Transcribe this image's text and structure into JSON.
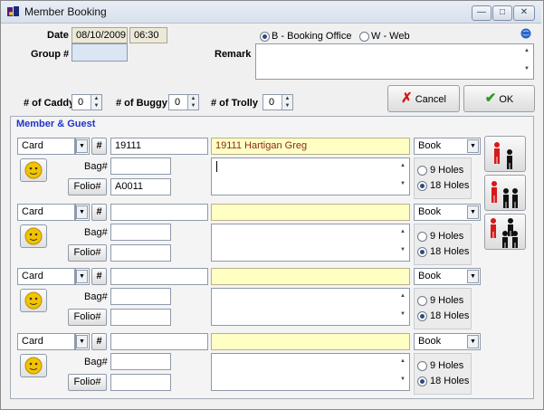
{
  "window": {
    "title": "Member Booking"
  },
  "header": {
    "date_label": "Date",
    "date_value": "08/10/2009",
    "time_value": "06:30",
    "group_label": "Group #",
    "group_value": "",
    "remark_label": "Remark",
    "booking_options": [
      {
        "label": "B - Booking Office",
        "selected": true
      },
      {
        "label": "W - Web",
        "selected": false
      }
    ],
    "caddy_label": "# of Caddy",
    "caddy_value": "0",
    "buggy_label": "# of Buggy",
    "buggy_value": "0",
    "trolly_label": "# of Trolly",
    "trolly_value": "0",
    "cancel_label": "Cancel",
    "ok_label": "OK"
  },
  "section": {
    "title": "Member & Guest"
  },
  "rows": [
    {
      "type": "Card",
      "hash": "#",
      "id": "19111",
      "name": "19111 Hartigan Greg",
      "status": "Book",
      "bag_label": "Bag#",
      "bag": "",
      "folio_label": "Folio#",
      "folio": "A0011",
      "hole_9": "9 Holes",
      "hole_18": "18 Holes",
      "selected_holes": "18"
    },
    {
      "type": "Card",
      "hash": "#",
      "id": "",
      "name": "",
      "status": "Book",
      "bag_label": "Bag#",
      "bag": "",
      "folio_label": "Folio#",
      "folio": "",
      "hole_9": "9 Holes",
      "hole_18": "18 Holes",
      "selected_holes": "18"
    },
    {
      "type": "Card",
      "hash": "#",
      "id": "",
      "name": "",
      "status": "Book",
      "bag_label": "Bag#",
      "bag": "",
      "folio_label": "Folio#",
      "folio": "",
      "hole_9": "9 Holes",
      "hole_18": "18 Holes",
      "selected_holes": "18"
    },
    {
      "type": "Card",
      "hash": "#",
      "id": "",
      "name": "",
      "status": "Book",
      "bag_label": "Bag#",
      "bag": "",
      "folio_label": "Folio#",
      "folio": "",
      "hole_9": "9 Holes",
      "hole_18": "18 Holes",
      "selected_holes": "18"
    }
  ],
  "icons": {
    "app": "golf-app-icon",
    "help": "globe-help-icon",
    "face": "smiley-face-icon",
    "cancel": "red-x-icon",
    "ok": "green-check-icon",
    "players": "players-icon"
  },
  "colors": {
    "highlight_name": "#ffffc4",
    "section_title": "#1f35c8",
    "cancel_icon": "#d11919",
    "ok_icon": "#2a9a1f"
  }
}
